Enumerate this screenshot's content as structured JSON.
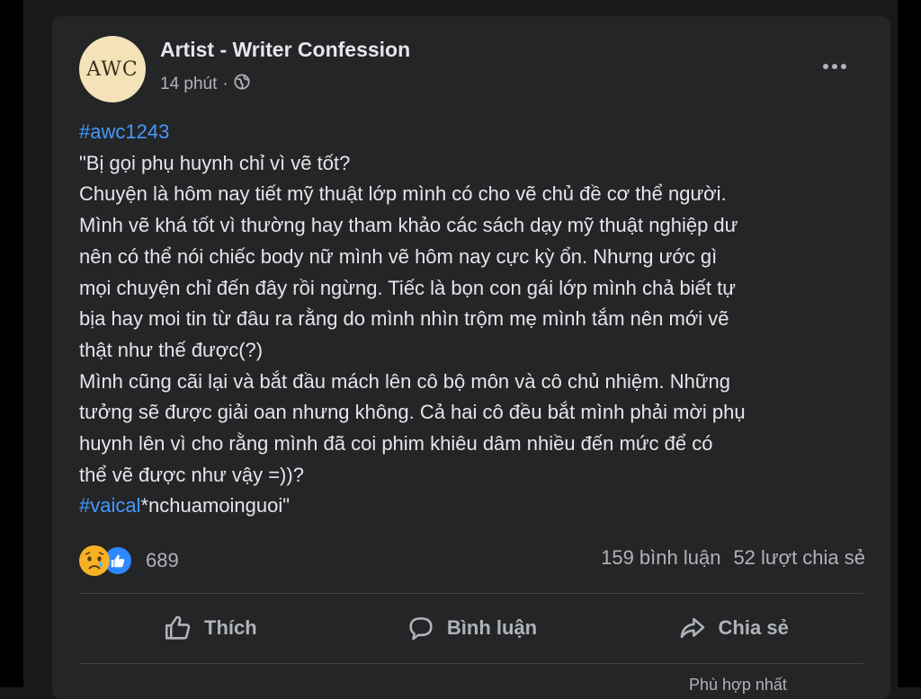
{
  "post": {
    "author": "Artist - Writer Confession",
    "avatar_text": "AWC",
    "time": "14 phút",
    "separator": "·",
    "privacy_icon": "globe-icon",
    "more_icon": "more-options-icon",
    "hashtag_top": "#awc1243",
    "body_lines": [
      "\"Bị gọi phụ huynh chỉ vì vẽ tốt?",
      "Chuyện là hôm nay tiết mỹ thuật lớp mình có cho vẽ chủ đề cơ thể người.",
      "Mình vẽ khá tốt vì thường hay tham khảo các sách dạy mỹ thuật nghiệp dư",
      "nên có thể nói chiếc body nữ mình vẽ hôm nay cực kỳ ổn. Nhưng ước gì",
      "mọi chuyện chỉ đến đây rồi ngừng. Tiếc là bọn con gái lớp mình chả biết tự",
      "bịa hay moi tin từ đâu ra rằng do mình nhìn trộm mẹ mình tắm nên mới vẽ",
      "thật như thế được(?)",
      "Mình cũng cãi lại và bắt đầu mách lên cô bộ môn và cô chủ nhiệm. Những",
      "tưởng sẽ được giải oan nhưng không. Cả hai cô đều bắt mình phải mời phụ",
      "huynh lên vì cho rằng mình đã coi phim khiêu dâm nhiều đến mức để có",
      "thể vẽ được như vậy =))?"
    ],
    "hashtag_bottom": "#vaical",
    "tail_text": "*nchuamoinguoi\""
  },
  "reactions": {
    "count": "689",
    "icons": [
      "sad-reaction-icon",
      "like-reaction-icon"
    ]
  },
  "stats": {
    "comments": "159 bình luận",
    "shares": "52 lượt chia sẻ"
  },
  "actions": {
    "like": "Thích",
    "comment": "Bình luận",
    "share": "Chia sẻ"
  },
  "bottom": {
    "partial_text": "Phù hợp nhất"
  },
  "colors": {
    "card_bg": "#242526",
    "text": "#e4e6eb",
    "secondary": "#b0b3b8",
    "hashtag": "#4599ff"
  }
}
